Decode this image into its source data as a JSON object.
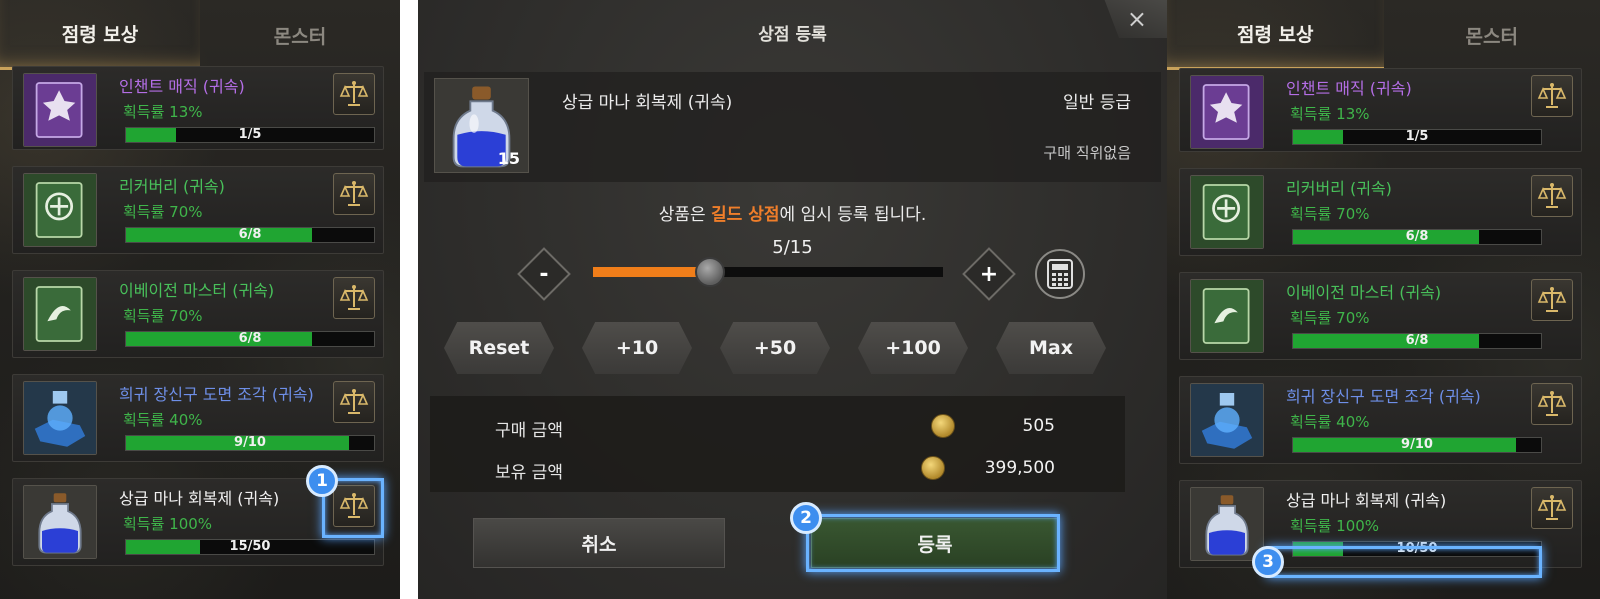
{
  "left": {
    "tabs": [
      "점령 보상",
      "몬스터"
    ],
    "items": [
      {
        "name": "인챈트 매직 (귀속)",
        "name_color": "#b46ee6",
        "rate": "획득률 13%",
        "progress": "1/5",
        "fill": 0.2
      },
      {
        "name": "리커버리 (귀속)",
        "name_color": "#48c05a",
        "rate": "획득률 70%",
        "progress": "6/8",
        "fill": 0.75
      },
      {
        "name": "이베이전 마스터 (귀속)",
        "name_color": "#48c05a",
        "rate": "획득률 70%",
        "progress": "6/8",
        "fill": 0.75
      },
      {
        "name": "희귀 장신구 도면 조각 (귀속)",
        "name_color": "#6e8fe8",
        "rate": "획득률 40%",
        "progress": "9/10",
        "fill": 0.9
      },
      {
        "name": "상급 마나 회복제 (귀속)",
        "name_color": "#f0f0f0",
        "rate": "획득률 100%",
        "progress": "15/50",
        "fill": 0.3
      }
    ],
    "badge": "1"
  },
  "modal": {
    "title": "상점 등록",
    "close_icon": "×",
    "item_name": "상급 마나 회복제 (귀속)",
    "item_qty": "15",
    "grade": "일반 등급",
    "buy_rank": "구매 직위없음",
    "notice_pre": "상품은 ",
    "notice_highlight": "길드 상점",
    "notice_post": "에 임시 등록 됩니다.",
    "count": "5/15",
    "slider_fraction": 0.3333,
    "minus_label": "-",
    "plus_label": "+",
    "quick_buttons": [
      "Reset",
      "+10",
      "+50",
      "+100",
      "Max"
    ],
    "price_label": "구매 금액",
    "price_value": "505",
    "owned_label": "보유 금액",
    "owned_value": "399,500",
    "cancel_label": "취소",
    "confirm_label": "등록",
    "badge": "2"
  },
  "right": {
    "tabs": [
      "점령 보상",
      "몬스터"
    ],
    "items": [
      {
        "name": "인챈트 매직 (귀속)",
        "name_color": "#b46ee6",
        "rate": "획득률 13%",
        "progress": "1/5",
        "fill": 0.2
      },
      {
        "name": "리커버리 (귀속)",
        "name_color": "#48c05a",
        "rate": "획득률 70%",
        "progress": "6/8",
        "fill": 0.75
      },
      {
        "name": "이베이전 마스터 (귀속)",
        "name_color": "#48c05a",
        "rate": "획득률 70%",
        "progress": "6/8",
        "fill": 0.75
      },
      {
        "name": "희귀 장신구 도면 조각 (귀속)",
        "name_color": "#6e8fe8",
        "rate": "획득률 40%",
        "progress": "9/10",
        "fill": 0.9
      },
      {
        "name": "상급 마나 회복제 (귀속)",
        "name_color": "#f0f0f0",
        "rate": "획득률 100%",
        "progress": "10/50",
        "fill": 0.2
      }
    ],
    "badge": "3"
  },
  "colors": {
    "accent": "#3d8eef",
    "progress_green": "#20a532",
    "slider_orange": "#f07e1a"
  },
  "icons": {
    "item_scale": "scale-icon",
    "calculator": "calculator-icon",
    "coin": "gold-coin-icon"
  }
}
